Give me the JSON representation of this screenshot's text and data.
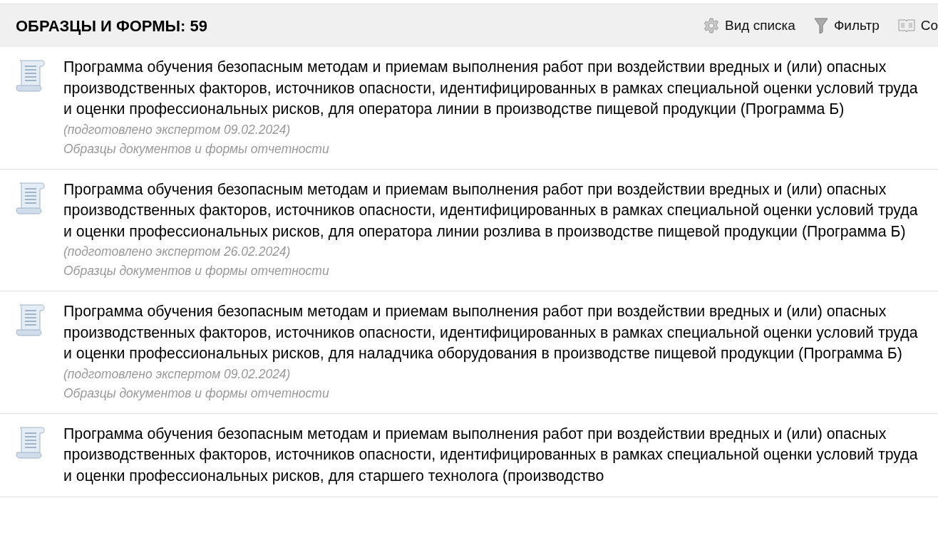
{
  "header": {
    "title": "ОБРАЗЦЫ И ФОРМЫ: 59",
    "tools": [
      {
        "kind": "view",
        "label": "Вид списка"
      },
      {
        "kind": "filter",
        "label": "Фильтр"
      },
      {
        "kind": "sort",
        "label": "Со"
      }
    ]
  },
  "documents": [
    {
      "title": "Программа обучения безопасным методам и приемам выполнения работ при воздействии вредных и (или) опасных производственных факторов, источников опасности, идентифицированных в рамках специальной оценки условий труда и оценки профессиональных рисков, для оператора линии в производстве пищевой продукции (Программа Б)",
      "note": "(подготовлено экспертом 09.02.2024)",
      "category": "Образцы документов и формы отчетности"
    },
    {
      "title": "Программа обучения безопасным методам и приемам выполнения работ при воздействии вредных и (или) опасных производственных факторов, источников опасности, идентифицированных в рамках специальной оценки условий труда и оценки профессиональных рисков, для оператора линии розлива в производстве пищевой продукции (Программа Б)",
      "note": "(подготовлено экспертом 26.02.2024)",
      "category": "Образцы документов и формы отчетности"
    },
    {
      "title": "Программа обучения безопасным методам и приемам выполнения работ при воздействии вредных и (или) опасных производственных факторов, источников опасности, идентифицированных в рамках специальной оценки условий труда и оценки профессиональных рисков, для наладчика оборудования в производстве пищевой продукции (Программа Б)",
      "note": "(подготовлено экспертом 09.02.2024)",
      "category": "Образцы документов и формы отчетности"
    },
    {
      "title": "Программа обучения безопасным методам и приемам выполнения работ при воздействии вредных и (или) опасных производственных факторов, источников опасности, идентифицированных в рамках специальной оценки условий труда и оценки профессиональных рисков, для старшего технолога (производство"
    }
  ]
}
